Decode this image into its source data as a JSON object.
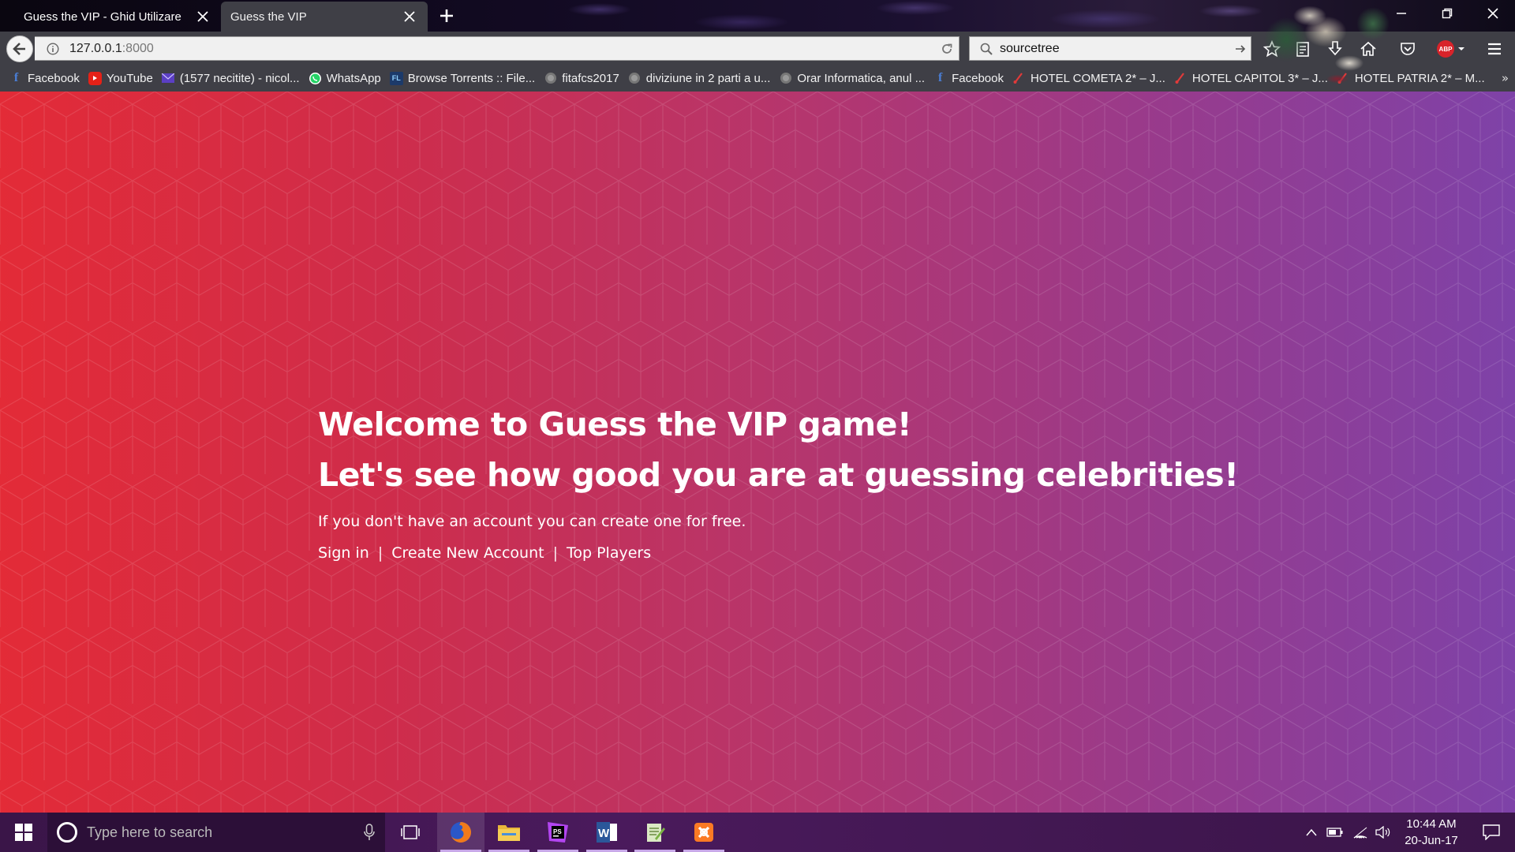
{
  "browser": {
    "tabs": [
      {
        "title": "Guess the VIP - Ghid Utilizare",
        "active": false
      },
      {
        "title": "Guess the VIP",
        "active": true
      }
    ],
    "url_host": "127.0.0.1",
    "url_port": ":8000",
    "search_value": "sourcetree",
    "bookmarks": [
      {
        "label": "Facebook",
        "icon": "facebook-icon"
      },
      {
        "label": "YouTube",
        "icon": "youtube-icon"
      },
      {
        "label": "(1577 necitite) - nicol...",
        "icon": "mail-icon"
      },
      {
        "label": "WhatsApp",
        "icon": "whatsapp-icon"
      },
      {
        "label": "Browse Torrents :: File...",
        "icon": "filelist-icon"
      },
      {
        "label": "fitafcs2017",
        "icon": "globe-icon"
      },
      {
        "label": "diviziune in 2 parti a u...",
        "icon": "globe-icon"
      },
      {
        "label": "Orar Informatica, anul ...",
        "icon": "globe-icon"
      },
      {
        "label": "Facebook",
        "icon": "facebook-icon"
      },
      {
        "label": "HOTEL COMETA 2* – J...",
        "icon": "hotel-icon"
      },
      {
        "label": "HOTEL CAPITOL 3* – J...",
        "icon": "hotel-icon"
      },
      {
        "label": "HOTEL PATRIA 2* – M...",
        "icon": "hotel-icon"
      }
    ],
    "bookmarks_more": "»",
    "adblock_label": "ABP"
  },
  "page": {
    "headline_line1": "Welcome to Guess the VIP game!",
    "headline_line2": "Let's see how good you are at guessing celebrities!",
    "subtext": "If you don't have an account you can create one for free.",
    "links": {
      "sign_in": "Sign in",
      "create_account": "Create New Account",
      "top_players": "Top Players",
      "separator": "|"
    }
  },
  "taskbar": {
    "search_placeholder": "Type here to search",
    "time": "10:44 AM",
    "date": "20-Jun-17",
    "apps": [
      "firefox-icon",
      "file-explorer-icon",
      "phpstorm-icon",
      "word-icon",
      "notepad-icon",
      "xampp-icon"
    ]
  },
  "colors": {
    "page_gradient_start": "#e32b37",
    "page_gradient_end": "#7e42a8",
    "chrome_bg": "#3f3f46",
    "taskbar_bg": "#3a1548"
  }
}
